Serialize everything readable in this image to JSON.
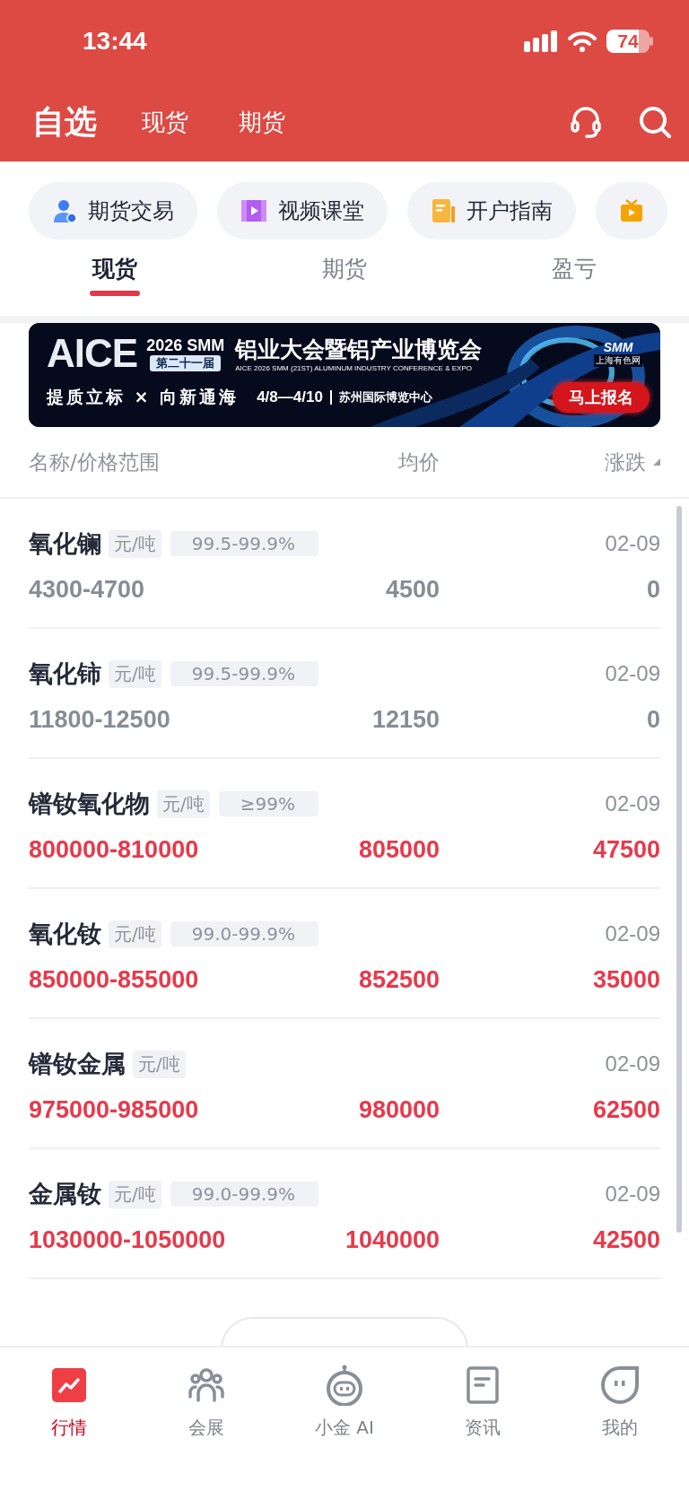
{
  "status_bar": {
    "time": "13:44",
    "battery": "74"
  },
  "header": {
    "title": "自选",
    "links": [
      {
        "label": "现货"
      },
      {
        "label": "期货"
      }
    ]
  },
  "quick_links": [
    {
      "label": "期货交易",
      "kind": "person"
    },
    {
      "label": "视频课堂",
      "kind": "video"
    },
    {
      "label": "开户指南",
      "kind": "guide"
    },
    {
      "kind": "tv"
    }
  ],
  "tabs": [
    {
      "label": "现货",
      "selected": true
    },
    {
      "label": "期货",
      "selected": false
    },
    {
      "label": "盈亏",
      "selected": false
    }
  ],
  "banner": {
    "brand": "AICE",
    "edition": "2026 SMM",
    "session": "第二十一届",
    "title": "铝业大会暨铝产业博览会",
    "subtitle": "AICE 2026 SMM (21ST) ALUMINUM INDUSTRY CONFERENCE & EXPO",
    "slogan": "提质立标 × 向新通海",
    "dates": "4/8—4/10",
    "venue": "苏州国际博览中心",
    "logo": "SMM",
    "logo_caption": "上海有色网",
    "cta": "马上报名"
  },
  "table": {
    "columns": [
      "名称/价格范围",
      "均价",
      "涨跌"
    ],
    "rows": [
      {
        "name": "氧化镧",
        "unit": "元/吨",
        "spec": "99.5-99.9%",
        "date": "02-09",
        "range": "4300-4700",
        "average": "4500",
        "change": "0",
        "color": "#878d96"
      },
      {
        "name": "氧化铈",
        "unit": "元/吨",
        "spec": "99.5-99.9%",
        "date": "02-09",
        "range": "11800-12500",
        "average": "12150",
        "change": "0",
        "color": "#878d96"
      },
      {
        "name": "镨钕氧化物",
        "unit": "元/吨",
        "spec": "≥99%",
        "date": "02-09",
        "range": "800000-810000",
        "average": "805000",
        "change": "47500",
        "color": "#e8394a"
      },
      {
        "name": "氧化钕",
        "unit": "元/吨",
        "spec": "99.0-99.9%",
        "date": "02-09",
        "range": "850000-855000",
        "average": "852500",
        "change": "35000",
        "color": "#e8394a"
      },
      {
        "name": "镨钕金属",
        "unit": "元/吨",
        "date": "02-09",
        "range": "975000-985000",
        "average": "980000",
        "change": "62500",
        "color": "#e8394a"
      },
      {
        "name": "金属钕",
        "unit": "元/吨",
        "spec": "99.0-99.9%",
        "date": "02-09",
        "range": "1030000-1050000",
        "average": "1040000",
        "change": "42500",
        "color": "#e8394a"
      }
    ]
  },
  "bottom_nav": [
    {
      "label": "行情",
      "kind": "market",
      "selected": true
    },
    {
      "label": "会展",
      "kind": "people",
      "selected": false
    },
    {
      "label": "小金 AI",
      "kind": "robot",
      "selected": false
    },
    {
      "label": "资讯",
      "kind": "news",
      "selected": false
    },
    {
      "label": "我的",
      "kind": "me",
      "selected": false
    }
  ]
}
